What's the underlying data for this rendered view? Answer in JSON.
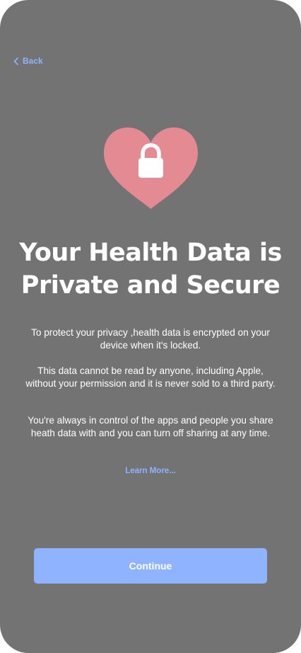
{
  "nav": {
    "back_label": "Back",
    "back_icon": "chevron-left-icon",
    "accent_color": "#8fb3ff"
  },
  "hero": {
    "icon": "heart-lock-icon",
    "heart_color": "#e48a92"
  },
  "content": {
    "title_line1": "Your Health Data is",
    "title_line2": "Private and Secure",
    "paragraph1": "To protect your privacy ,health data is encrypted on your device when it's locked.",
    "paragraph2": "This data cannot be read by anyone, including Apple, without your permission and it is never sold to a third party.",
    "paragraph3": "You're always in control of the apps and people you share heath data with and you can turn off sharing at any time.",
    "learn_more": "Learn More..."
  },
  "actions": {
    "continue_label": "Continue"
  },
  "theme": {
    "background": "#737373",
    "text": "#ffffff"
  }
}
